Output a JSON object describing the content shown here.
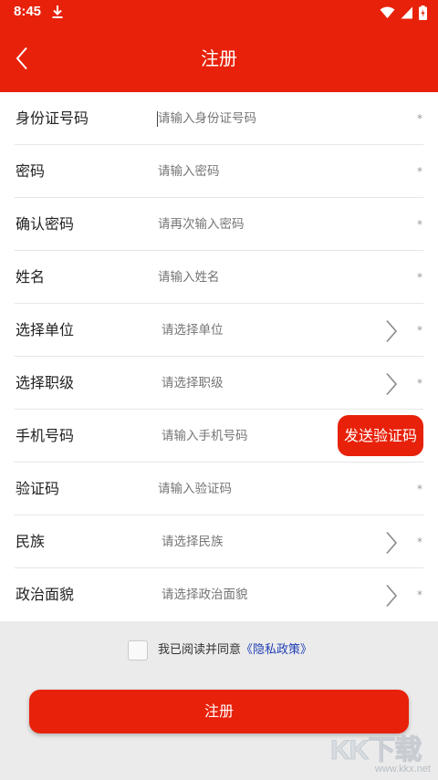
{
  "status_bar": {
    "time": "8:45",
    "icons": [
      "download-icon",
      "wifi-icon",
      "signal-icon",
      "battery-charging-icon"
    ]
  },
  "header": {
    "title": "注册",
    "back_icon": "chevron-left-icon"
  },
  "form": {
    "rows": [
      {
        "label": "身份证号码",
        "placeholder": "请输入身份证号码",
        "required": "*",
        "type": "text",
        "focused": true
      },
      {
        "label": "密码",
        "placeholder": "请输入密码",
        "required": "*",
        "type": "text"
      },
      {
        "label": "确认密码",
        "placeholder": "请再次输入密码",
        "required": "*",
        "type": "text"
      },
      {
        "label": "姓名",
        "placeholder": "请输入姓名",
        "required": "*",
        "type": "text"
      },
      {
        "label": "选择单位",
        "placeholder": "请选择单位",
        "required": "*",
        "type": "select"
      },
      {
        "label": "选择职级",
        "placeholder": "请选择职级",
        "required": "*",
        "type": "select"
      },
      {
        "label": "手机号码",
        "placeholder": "请输入手机号码",
        "type": "phone",
        "send_code_label": "发送验证码"
      },
      {
        "label": "验证码",
        "placeholder": "请输入验证码",
        "required": "*",
        "type": "text"
      },
      {
        "label": "民族",
        "placeholder": "请选择民族",
        "required": "*",
        "type": "select"
      },
      {
        "label": "政治面貌",
        "placeholder": "请选择政治面貌",
        "required": "*",
        "type": "select"
      }
    ]
  },
  "agreement": {
    "text": "我已阅读并同意",
    "link": "《隐私政策》",
    "checked": false
  },
  "register_button": "注册",
  "watermark": {
    "logo": "KK下载",
    "url": "www.kkx.net"
  },
  "colors": {
    "brand_red": "#e8210a",
    "link_blue": "#1f3fb5",
    "placeholder": "#b3b3b3",
    "background": "#ebebeb"
  }
}
